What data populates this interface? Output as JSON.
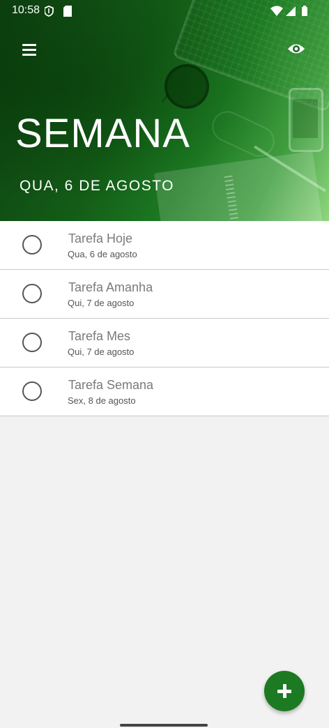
{
  "status_bar": {
    "time": "10:58",
    "left_icons": [
      "shield-icon",
      "sd-card-icon"
    ],
    "right_icons": [
      "wifi-icon",
      "signal-icon",
      "battery-icon"
    ]
  },
  "header": {
    "title": "SEMANA",
    "subtitle": "QUA, 6 DE AGOSTO",
    "menu_icon": "hamburger-menu-icon",
    "action_icon": "eye-icon"
  },
  "tasks": [
    {
      "title": "Tarefa Hoje",
      "date": "Qua, 6 de agosto"
    },
    {
      "title": "Tarefa Amanha",
      "date": "Qui, 7 de agosto"
    },
    {
      "title": "Tarefa Mes",
      "date": "Qui, 7 de agosto"
    },
    {
      "title": "Tarefa Semana",
      "date": "Sex, 8 de agosto"
    }
  ],
  "fab": {
    "icon": "plus-icon"
  },
  "colors": {
    "accent": "#1c7a22",
    "background": "#f2f2f2",
    "header_dark": "#0d3f10",
    "header_light": "#8fd67f"
  }
}
